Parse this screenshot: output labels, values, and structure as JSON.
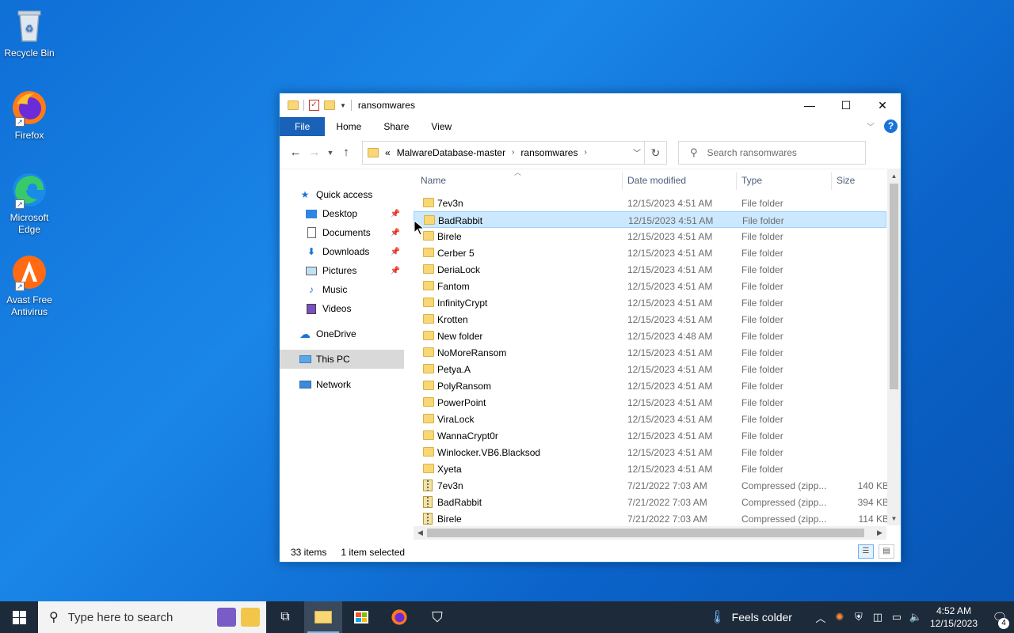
{
  "desktop": {
    "icons": [
      {
        "label": "Recycle Bin"
      },
      {
        "label": "Firefox"
      },
      {
        "label": "Microsoft Edge"
      },
      {
        "label": "Avast Free Antivirus"
      }
    ]
  },
  "window": {
    "title": "ransomwares",
    "ribbon": {
      "file": "File",
      "home": "Home",
      "share": "Share",
      "view": "View"
    },
    "address": {
      "overflow": "«",
      "crumbs": [
        "MalwareDatabase-master",
        "ransomwares"
      ]
    },
    "search_placeholder": "Search ransomwares",
    "columns": {
      "name": "Name",
      "date": "Date modified",
      "type": "Type",
      "size": "Size"
    },
    "nav": {
      "quick_access": "Quick access",
      "desktop": "Desktop",
      "documents": "Documents",
      "downloads": "Downloads",
      "pictures": "Pictures",
      "music": "Music",
      "videos": "Videos",
      "onedrive": "OneDrive",
      "thispc": "This PC",
      "network": "Network"
    },
    "files": [
      {
        "name": "7ev3n",
        "date": "12/15/2023 4:51 AM",
        "type": "File folder",
        "size": "",
        "kind": "folder"
      },
      {
        "name": "BadRabbit",
        "date": "12/15/2023 4:51 AM",
        "type": "File folder",
        "size": "",
        "kind": "folder"
      },
      {
        "name": "Birele",
        "date": "12/15/2023 4:51 AM",
        "type": "File folder",
        "size": "",
        "kind": "folder"
      },
      {
        "name": "Cerber 5",
        "date": "12/15/2023 4:51 AM",
        "type": "File folder",
        "size": "",
        "kind": "folder"
      },
      {
        "name": "DeriaLock",
        "date": "12/15/2023 4:51 AM",
        "type": "File folder",
        "size": "",
        "kind": "folder"
      },
      {
        "name": "Fantom",
        "date": "12/15/2023 4:51 AM",
        "type": "File folder",
        "size": "",
        "kind": "folder"
      },
      {
        "name": "InfinityCrypt",
        "date": "12/15/2023 4:51 AM",
        "type": "File folder",
        "size": "",
        "kind": "folder"
      },
      {
        "name": "Krotten",
        "date": "12/15/2023 4:51 AM",
        "type": "File folder",
        "size": "",
        "kind": "folder"
      },
      {
        "name": "New folder",
        "date": "12/15/2023 4:48 AM",
        "type": "File folder",
        "size": "",
        "kind": "folder"
      },
      {
        "name": "NoMoreRansom",
        "date": "12/15/2023 4:51 AM",
        "type": "File folder",
        "size": "",
        "kind": "folder"
      },
      {
        "name": "Petya.A",
        "date": "12/15/2023 4:51 AM",
        "type": "File folder",
        "size": "",
        "kind": "folder"
      },
      {
        "name": "PolyRansom",
        "date": "12/15/2023 4:51 AM",
        "type": "File folder",
        "size": "",
        "kind": "folder"
      },
      {
        "name": "PowerPoint",
        "date": "12/15/2023 4:51 AM",
        "type": "File folder",
        "size": "",
        "kind": "folder"
      },
      {
        "name": "ViraLock",
        "date": "12/15/2023 4:51 AM",
        "type": "File folder",
        "size": "",
        "kind": "folder"
      },
      {
        "name": "WannaCrypt0r",
        "date": "12/15/2023 4:51 AM",
        "type": "File folder",
        "size": "",
        "kind": "folder"
      },
      {
        "name": "Winlocker.VB6.Blacksod",
        "date": "12/15/2023 4:51 AM",
        "type": "File folder",
        "size": "",
        "kind": "folder"
      },
      {
        "name": "Xyeta",
        "date": "12/15/2023 4:51 AM",
        "type": "File folder",
        "size": "",
        "kind": "folder"
      },
      {
        "name": "7ev3n",
        "date": "7/21/2022 7:03 AM",
        "type": "Compressed (zipp...",
        "size": "140 KB",
        "kind": "zip"
      },
      {
        "name": "BadRabbit",
        "date": "7/21/2022 7:03 AM",
        "type": "Compressed (zipp...",
        "size": "394 KB",
        "kind": "zip"
      },
      {
        "name": "Birele",
        "date": "7/21/2022 7:03 AM",
        "type": "Compressed (zipp...",
        "size": "114 KB",
        "kind": "zip"
      }
    ],
    "selected_index": 1,
    "status": {
      "count": "33 items",
      "selected": "1 item selected"
    }
  },
  "taskbar": {
    "search_placeholder": "Type here to search",
    "weather": "Feels colder",
    "time": "4:52 AM",
    "date": "12/15/2023",
    "notifications": "4"
  }
}
